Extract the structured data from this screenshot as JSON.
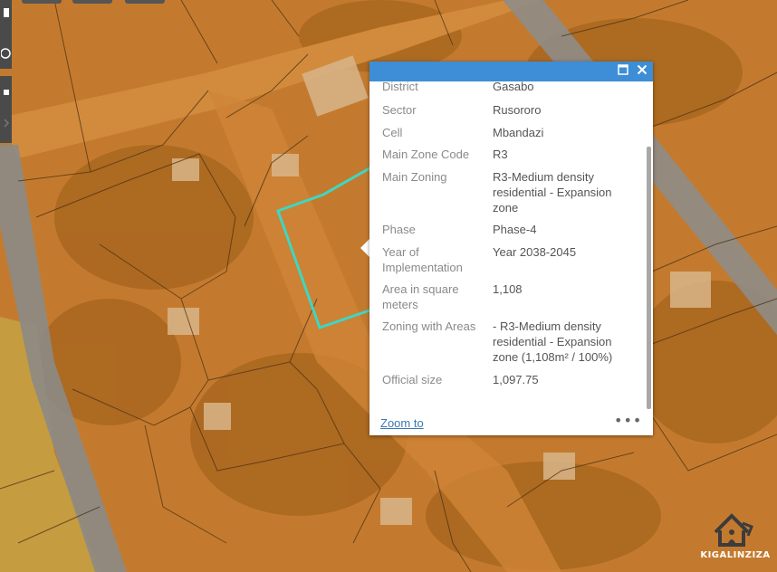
{
  "map": {
    "highlight_color": "#3fd6c2",
    "popup": {
      "header_color": "#3d8ed6",
      "maximize_icon": "maximize-icon",
      "close_icon": "close-icon",
      "rows": [
        {
          "label": "District",
          "value": "Gasabo"
        },
        {
          "label": "Sector",
          "value": "Rusororo"
        },
        {
          "label": "Cell",
          "value": "Mbandazi"
        },
        {
          "label": "Main Zone Code",
          "value": "R3"
        },
        {
          "label": "Main Zoning",
          "value": "R3-Medium density residential - Expansion zone"
        },
        {
          "label": "Phase",
          "value": "Phase-4"
        },
        {
          "label": "Year of Implementation",
          "value": "Year 2038-2045"
        },
        {
          "label": "Area in square meters",
          "value": "1,108"
        },
        {
          "label": "Zoning with Areas",
          "value": "- R3-Medium density residential - Expansion zone (1,108m² / 100%)"
        },
        {
          "label": "Official size",
          "value": "1,097.75"
        }
      ],
      "zoom_link": "Zoom to",
      "more_icon": "more-options-icon"
    }
  },
  "logo": {
    "text": "KIGALINZIZA"
  }
}
